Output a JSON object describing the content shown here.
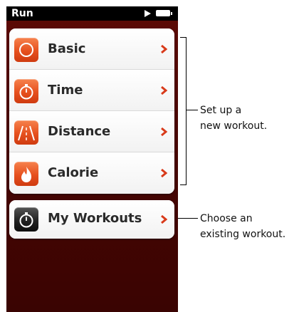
{
  "status_bar": {
    "title": "Run",
    "icons": [
      "play-icon",
      "battery-icon"
    ]
  },
  "menu": {
    "items": [
      {
        "label": "Basic",
        "icon": "circle-icon"
      },
      {
        "label": "Time",
        "icon": "stopwatch-icon"
      },
      {
        "label": "Distance",
        "icon": "road-icon"
      },
      {
        "label": "Calorie",
        "icon": "flame-icon"
      }
    ],
    "my_workouts": {
      "label": "My Workouts",
      "icon": "stopwatch-icon"
    }
  },
  "annotations": {
    "setup_line1": "Set up a",
    "setup_line2": "new workout.",
    "choose_line1": "Choose an",
    "choose_line2": "existing workout."
  },
  "colors": {
    "background": "#4a0603",
    "accent_orange": "#e6501e",
    "chevron_red": "#d83a1a",
    "card": "#fbfbfb"
  }
}
